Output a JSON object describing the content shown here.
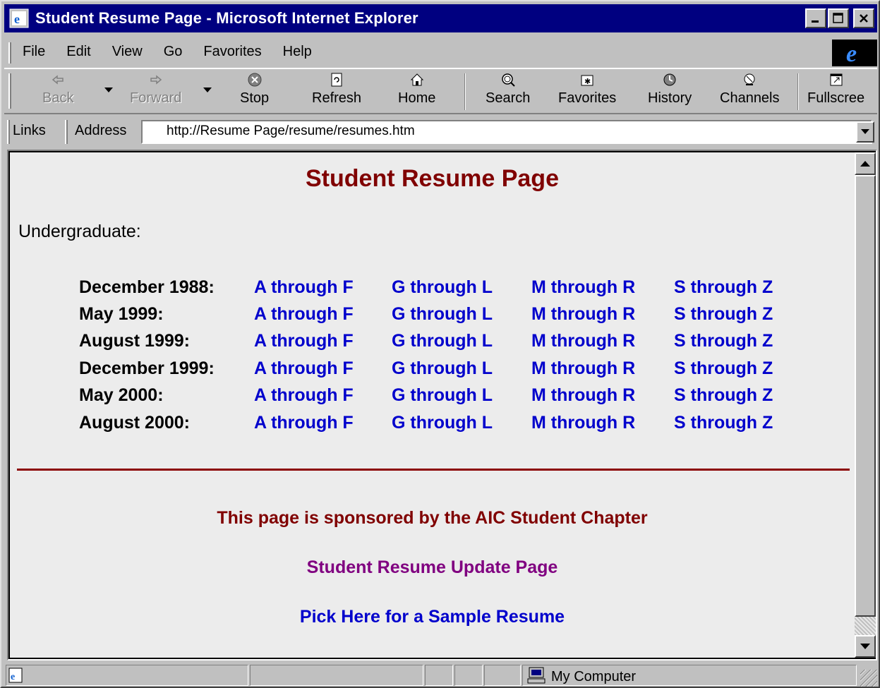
{
  "window": {
    "title": "Student Resume Page - Microsoft Internet Explorer"
  },
  "menu": {
    "items": [
      {
        "label": "File",
        "accel": "F"
      },
      {
        "label": "Edit",
        "accel": "E"
      },
      {
        "label": "View",
        "accel": "V"
      },
      {
        "label": "Go",
        "accel": "G"
      },
      {
        "label": "Favorites",
        "accel": "a"
      },
      {
        "label": "Help",
        "accel": "H"
      }
    ]
  },
  "toolbar": {
    "back": "Back",
    "forward": "Forward",
    "stop": "Stop",
    "refresh": "Refresh",
    "home": "Home",
    "search": "Search",
    "favorites": "Favorites",
    "history": "History",
    "channels": "Channels",
    "fullscreen": "Fullscree"
  },
  "addressbar": {
    "links_label": "Links",
    "address_label": "Address",
    "url": "http://Resume Page/resume/resumes.htm"
  },
  "page": {
    "title": "Student Resume Page",
    "section_label": "Undergraduate:",
    "rows": [
      {
        "date": "December 1988:",
        "links": [
          "A through F",
          "G through L",
          "M through R",
          "S through Z"
        ]
      },
      {
        "date": "May 1999:",
        "links": [
          "A through F",
          "G through L",
          "M through R",
          "S through Z"
        ]
      },
      {
        "date": "August 1999:",
        "links": [
          "A through F",
          "G through L",
          "M through R",
          "S through Z"
        ]
      },
      {
        "date": "December 1999:",
        "links": [
          "A through F",
          "G through L",
          "M through R",
          "S through Z"
        ]
      },
      {
        "date": "May 2000:",
        "links": [
          "A through F",
          "G through L",
          "M through R",
          "S through Z"
        ]
      },
      {
        "date": "August 2000:",
        "links": [
          "A through F",
          "G through L",
          "M through R",
          "S through Z"
        ]
      }
    ],
    "sponsor_text": "This page is sponsored by the AIC Student Chapter",
    "update_link": "Student Resume Update Page",
    "sample_link": "Pick Here for a Sample Resume"
  },
  "statusbar": {
    "zone": "My Computer"
  },
  "colors": {
    "titlebar": "#000080",
    "heading": "#800000",
    "link": "#0000cc",
    "visited_link": "#800080",
    "rule": "#8b0000"
  }
}
